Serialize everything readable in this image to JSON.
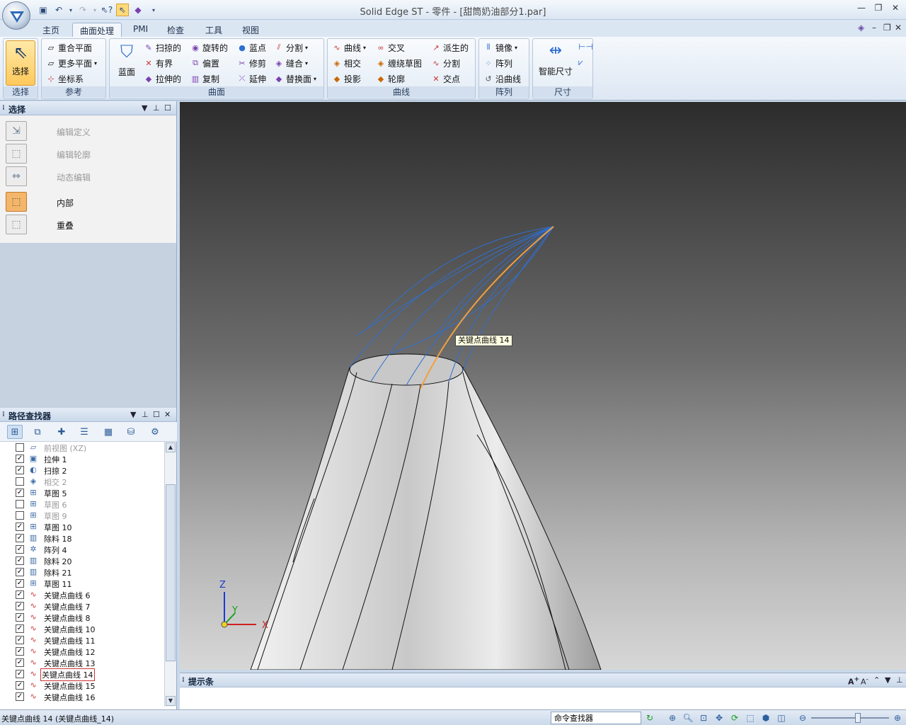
{
  "window": {
    "title": "Solid Edge ST - 零件 - [甜筒奶油部分1.par]"
  },
  "tabs": [
    "主页",
    "曲面处理",
    "PMI",
    "检查",
    "工具",
    "视图"
  ],
  "ribbon": {
    "select": {
      "label": "选择",
      "group": "选择"
    },
    "reference": {
      "group": "参考",
      "items": [
        "重合平面",
        "更多平面",
        "坐标系"
      ]
    },
    "surface": {
      "group": "曲面",
      "big": "蓝面",
      "col1": [
        "扫掠的",
        "有界",
        "拉伸的"
      ],
      "col2": [
        "旋转的",
        "偏置",
        "复制"
      ],
      "col3": [
        "蓝点",
        "修剪",
        "延伸"
      ],
      "col4": [
        "分割",
        "缝合",
        "替换面"
      ]
    },
    "curves": {
      "group": "曲线",
      "col1": [
        "曲线",
        "相交",
        "投影"
      ],
      "col2": [
        "交叉",
        "缠绕草图",
        "轮廓"
      ],
      "col3": [
        "派生的",
        "分割",
        "交点"
      ]
    },
    "pattern": {
      "group": "阵列",
      "items": [
        "镜像",
        "阵列",
        "沿曲线"
      ]
    },
    "dimension": {
      "group": "尺寸",
      "big": "智能尺寸"
    }
  },
  "select_panel": {
    "title": "选择",
    "items": [
      {
        "label": "编辑定义",
        "enabled": false,
        "icon": "edit-definition-icon"
      },
      {
        "label": "编辑轮廓",
        "enabled": false,
        "icon": "edit-profile-icon"
      },
      {
        "label": "动态编辑",
        "enabled": false,
        "icon": "dynamic-edit-icon"
      },
      {
        "label": "内部",
        "enabled": true,
        "icon": "inside-select-icon"
      },
      {
        "label": "重叠",
        "enabled": true,
        "icon": "overlap-select-icon"
      }
    ]
  },
  "pathfinder": {
    "title": "路径查找器",
    "rows": [
      {
        "label": "前视图 (XZ)",
        "checked": false,
        "dim": true,
        "icon": "plane-icon"
      },
      {
        "label": "拉伸 1",
        "checked": true,
        "dim": false,
        "icon": "extrude-icon"
      },
      {
        "label": "扫掠 2",
        "checked": true,
        "dim": false,
        "icon": "sweep-icon"
      },
      {
        "label": "相交 2",
        "checked": false,
        "dim": true,
        "icon": "intersect-icon"
      },
      {
        "label": "草图 5",
        "checked": true,
        "dim": false,
        "icon": "sketch-icon"
      },
      {
        "label": "草图 6",
        "checked": false,
        "dim": true,
        "icon": "sketch-icon"
      },
      {
        "label": "草图 9",
        "checked": false,
        "dim": true,
        "icon": "sketch-icon"
      },
      {
        "label": "草图 10",
        "checked": true,
        "dim": false,
        "icon": "sketch-icon"
      },
      {
        "label": "除料 18",
        "checked": true,
        "dim": false,
        "icon": "cutout-icon"
      },
      {
        "label": "阵列 4",
        "checked": true,
        "dim": false,
        "icon": "pattern-icon"
      },
      {
        "label": "除料 20",
        "checked": true,
        "dim": false,
        "icon": "cutout-icon"
      },
      {
        "label": "除料 21",
        "checked": true,
        "dim": false,
        "icon": "cutout-icon"
      },
      {
        "label": "草图 11",
        "checked": true,
        "dim": false,
        "icon": "sketch-icon"
      },
      {
        "label": "关键点曲线 6",
        "checked": true,
        "dim": false,
        "icon": "keypoint-curve-icon"
      },
      {
        "label": "关键点曲线 7",
        "checked": true,
        "dim": false,
        "icon": "keypoint-curve-icon"
      },
      {
        "label": "关键点曲线 8",
        "checked": true,
        "dim": false,
        "icon": "keypoint-curve-icon"
      },
      {
        "label": "关键点曲线 10",
        "checked": true,
        "dim": false,
        "icon": "keypoint-curve-icon"
      },
      {
        "label": "关键点曲线 11",
        "checked": true,
        "dim": false,
        "icon": "keypoint-curve-icon"
      },
      {
        "label": "关键点曲线 12",
        "checked": true,
        "dim": false,
        "icon": "keypoint-curve-icon"
      },
      {
        "label": "关键点曲线 13",
        "checked": true,
        "dim": false,
        "icon": "keypoint-curve-icon"
      },
      {
        "label": "关键点曲线 14",
        "checked": true,
        "dim": false,
        "icon": "keypoint-curve-icon",
        "selected": true
      },
      {
        "label": "关键点曲线 15",
        "checked": true,
        "dim": false,
        "icon": "keypoint-curve-icon"
      },
      {
        "label": "关键点曲线 16",
        "checked": true,
        "dim": false,
        "icon": "keypoint-curve-icon"
      }
    ]
  },
  "viewport": {
    "tooltip": "关键点曲线 14",
    "axes": {
      "z": "Z",
      "y": "Y",
      "x": "X"
    },
    "colors": {
      "curve": "#2f6fd0",
      "highlight": "#f0a040"
    }
  },
  "promptbar": {
    "title": "提示条"
  },
  "status": {
    "text": "关键点曲线 14 (关键点曲线_14)",
    "command_finder": "命令查找器"
  }
}
